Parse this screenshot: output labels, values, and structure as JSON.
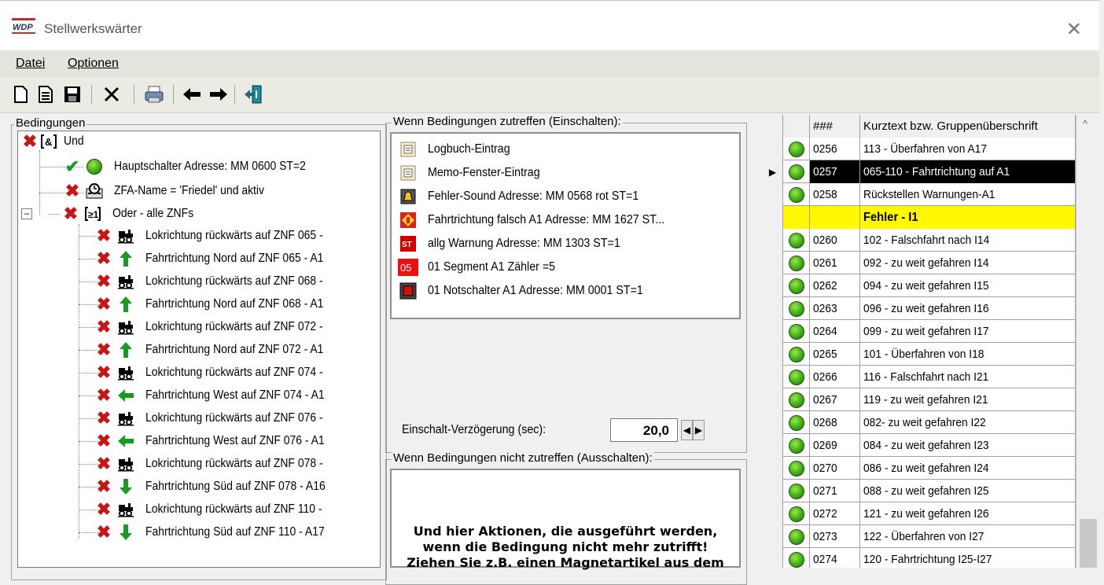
{
  "window": {
    "title": "Stellwerkswärter",
    "app_logo_text": "WDP"
  },
  "menu": [
    {
      "label": "Datei"
    },
    {
      "label": "Optionen"
    }
  ],
  "toolbar": {
    "buttons": [
      "new-icon",
      "open-icon",
      "save-icon",
      "delete-icon",
      "print-icon",
      "arrow-left-icon",
      "arrow-right-icon",
      "exit-icon"
    ]
  },
  "conditions": {
    "group_label": "Bedingungen",
    "root": {
      "label": "Und",
      "status": "false"
    },
    "items": [
      {
        "label": "Hauptschalter Adresse: MM 0600 ST=2",
        "status": "true",
        "icon": "green-light-icon"
      },
      {
        "label": "ZFA-Name = 'Friedel' und aktiv",
        "status": "false",
        "icon": "clock-icon"
      },
      {
        "label": "Oder - alle ZNFs",
        "status": "false",
        "icon": "or-gate-icon"
      }
    ],
    "children": [
      {
        "label": "Lokrichtung rückwärts auf ZNF 065 -",
        "icon": "loco-icon"
      },
      {
        "label": "Fahrtrichtung Nord auf ZNF 065 - A1",
        "icon": "arrow-up-icon"
      },
      {
        "label": "Lokrichtung rückwärts auf ZNF 068 -",
        "icon": "loco-icon"
      },
      {
        "label": "Fahrtrichtung Nord auf ZNF 068 - A1",
        "icon": "arrow-up-icon"
      },
      {
        "label": "Lokrichtung rückwärts auf ZNF 072 -",
        "icon": "loco-icon"
      },
      {
        "label": "Fahrtrichtung Nord auf ZNF 072 - A1",
        "icon": "arrow-up-icon"
      },
      {
        "label": "Lokrichtung rückwärts auf ZNF 074 -",
        "icon": "loco-icon"
      },
      {
        "label": "Fahrtrichtung West auf ZNF 074 - A1",
        "icon": "arrow-left-icon"
      },
      {
        "label": "Lokrichtung rückwärts auf ZNF 076 -",
        "icon": "loco-icon"
      },
      {
        "label": "Fahrtrichtung West auf ZNF 076 - A1",
        "icon": "arrow-left-icon"
      },
      {
        "label": "Lokrichtung rückwärts auf ZNF 078 -",
        "icon": "loco-icon"
      },
      {
        "label": "Fahrtrichtung Süd auf ZNF 078 - A16",
        "icon": "arrow-down-icon"
      },
      {
        "label": "Lokrichtung rückwärts auf ZNF 110 -",
        "icon": "loco-icon"
      },
      {
        "label": "Fahrtrichtung Süd auf ZNF 110 - A17",
        "icon": "arrow-down-icon"
      }
    ]
  },
  "on_actions": {
    "group_label": "Wenn Bedingungen zutreffen (Einschalten):",
    "items": [
      {
        "label": "Logbuch-Eintrag",
        "icon": "logbook-icon"
      },
      {
        "label": "Memo-Fenster-Eintrag",
        "icon": "memo-icon"
      },
      {
        "label": "Fehler-Sound Adresse: MM 0568 rot ST=1",
        "icon": "bell-icon"
      },
      {
        "label": "Fahrtrichtung falsch A1 Adresse: MM 1627 ST...",
        "icon": "warning-sign-icon"
      },
      {
        "label": "allg Warnung Adresse: MM 1303 ST=1",
        "icon": "stop-sign-icon",
        "badge": "ST"
      },
      {
        "label": "01 Segment  A1 Zähler =5",
        "icon": "counter-icon",
        "badge": "05"
      },
      {
        "label": "01 Notschalter A1 Adresse: MM 0001 ST=1",
        "icon": "emergency-switch-icon"
      }
    ],
    "delay_label": "Einschalt-Verzögerung (sec):",
    "delay_value": "20,0"
  },
  "off_actions": {
    "group_label": "Wenn Bedingungen nicht zutreffen (Ausschalten):",
    "hint_line1": "Und hier Aktionen, die ausgeführt werden,",
    "hint_line2": "wenn die Bedingung nicht mehr zutrifft!",
    "hint_line3": "Ziehen Sie z.B. einen Magnetartikel aus dem"
  },
  "grid": {
    "headers": {
      "num": "###",
      "text": "Kurztext bzw. Gruppenüberschrift"
    },
    "rows": [
      {
        "num": "0256",
        "text": "113 - Überfahren von A17",
        "led": true
      },
      {
        "num": "0257",
        "text": "065-110 - Fahrtrichtung auf A1",
        "led": true,
        "selected": true
      },
      {
        "num": "0258",
        "text": "Rückstellen Warnungen-A1",
        "led": true
      },
      {
        "num": "",
        "text": "Fehler - I1",
        "led": false,
        "group": true
      },
      {
        "num": "0260",
        "text": "102 - Falschfahrt nach I14",
        "led": true
      },
      {
        "num": "0261",
        "text": "092 - zu weit gefahren  I14",
        "led": true
      },
      {
        "num": "0262",
        "text": "094 - zu weit gefahren  I15",
        "led": true
      },
      {
        "num": "0263",
        "text": "096 - zu weit gefahren  I16",
        "led": true
      },
      {
        "num": "0264",
        "text": "099 - zu weit gefahren  I17",
        "led": true
      },
      {
        "num": "0265",
        "text": "101 - Überfahren von I18",
        "led": true
      },
      {
        "num": "0266",
        "text": "116 - Falschfahrt nach I21",
        "led": true
      },
      {
        "num": "0267",
        "text": "119 - zu weit gefahren  I21",
        "led": true
      },
      {
        "num": "0268",
        "text": "082-  zu weit gefahren  I22",
        "led": true
      },
      {
        "num": "0269",
        "text": "084 - zu weit gefahren I23",
        "led": true
      },
      {
        "num": "0270",
        "text": "086 - zu weit gefahren I24",
        "led": true
      },
      {
        "num": "0271",
        "text": "088 - zu weit gefahren I25",
        "led": true
      },
      {
        "num": "0272",
        "text": "121 - zu weit gefahren I26",
        "led": true
      },
      {
        "num": "0273",
        "text": "122 - Überfahren von I27",
        "led": true
      },
      {
        "num": "0274",
        "text": "120 - Fahrtrichtung I25-I27",
        "led": true
      }
    ]
  }
}
